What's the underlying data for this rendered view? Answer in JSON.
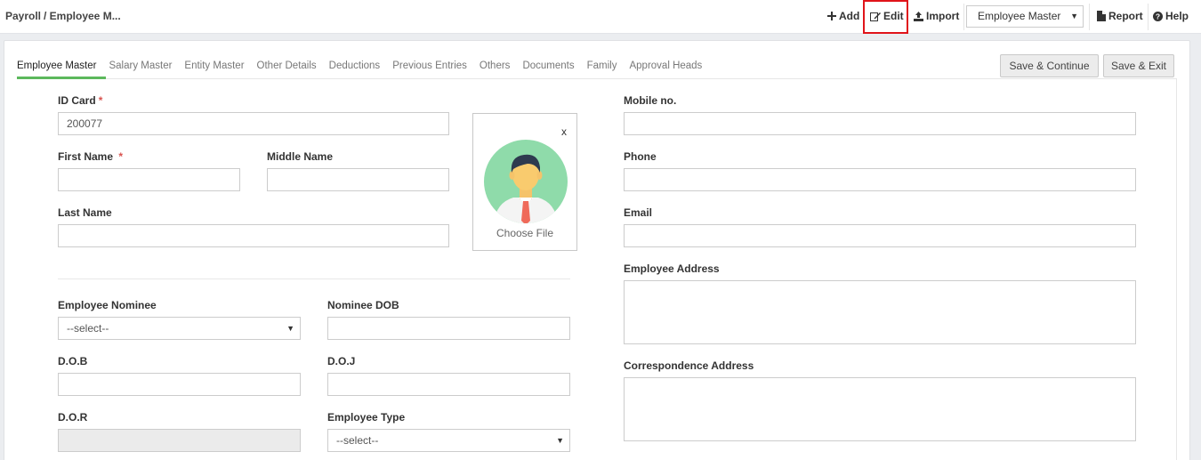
{
  "breadcrumb": {
    "root": "Payroll",
    "current": "/ Employee M..."
  },
  "toolbar": {
    "add": "Add",
    "edit": "Edit",
    "import": "Import",
    "master_select": "Employee Master",
    "report": "Report",
    "help": "Help",
    "edit_highlight_color": "#e0141a"
  },
  "tabs": [
    "Employee Master",
    "Salary Master",
    "Entity Master",
    "Other Details",
    "Deductions",
    "Previous Entries",
    "Others",
    "Documents",
    "Family",
    "Approval Heads"
  ],
  "active_tab_color": "#5cb85c",
  "actions": {
    "save_continue": "Save & Continue",
    "save_exit": "Save & Exit"
  },
  "form": {
    "id_card": {
      "label": "ID Card",
      "value": "200077"
    },
    "first_name": {
      "label": "First Name",
      "value": ""
    },
    "middle_name": {
      "label": "Middle Name",
      "value": ""
    },
    "last_name": {
      "label": "Last Name",
      "value": ""
    },
    "photo": {
      "close": "x",
      "choose": "Choose File"
    },
    "employee_nominee": {
      "label": "Employee Nominee",
      "value": "--select--"
    },
    "nominee_dob": {
      "label": "Nominee DOB",
      "value": ""
    },
    "dob": {
      "label": "D.O.B",
      "value": ""
    },
    "doj": {
      "label": "D.O.J",
      "value": ""
    },
    "dor": {
      "label": "D.O.R",
      "value": ""
    },
    "employee_type": {
      "label": "Employee Type",
      "value": "--select--"
    },
    "mobile": {
      "label": "Mobile no.",
      "value": ""
    },
    "phone": {
      "label": "Phone",
      "value": ""
    },
    "email": {
      "label": "Email",
      "value": ""
    },
    "employee_address": {
      "label": "Employee Address",
      "value": ""
    },
    "correspondence_address": {
      "label": "Correspondence Address",
      "value": ""
    }
  }
}
